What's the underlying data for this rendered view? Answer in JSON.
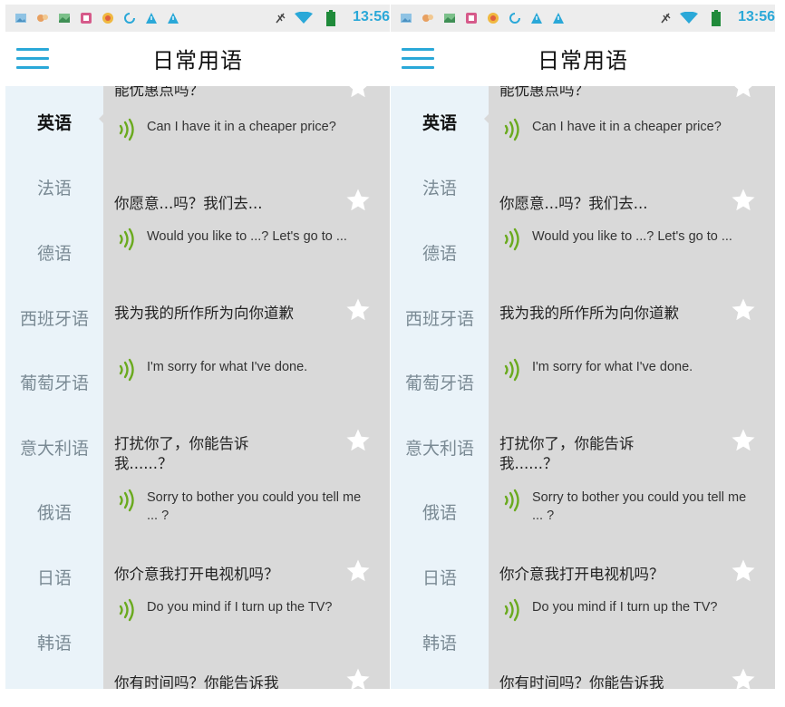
{
  "status_bar": {
    "time": "13:56",
    "colors": {
      "accent": "#2aa8d8",
      "battery": "#1f8a3a",
      "wifi": "#2aa8d8"
    }
  },
  "app_bar": {
    "title": "日常用语",
    "menu_icon": "hamburger-menu-icon"
  },
  "sidebar": {
    "items": [
      {
        "label": "英语",
        "active": true
      },
      {
        "label": "法语",
        "active": false
      },
      {
        "label": "德语",
        "active": false
      },
      {
        "label": "西班牙语",
        "active": false
      },
      {
        "label": "葡萄牙语",
        "active": false
      },
      {
        "label": "意大利语",
        "active": false
      },
      {
        "label": "俄语",
        "active": false
      },
      {
        "label": "日语",
        "active": false
      },
      {
        "label": "韩语",
        "active": false
      }
    ]
  },
  "phrases": {
    "partial_top": "能优惠点吗？",
    "items": [
      {
        "cn": "",
        "en": "Can I have it in a cheaper price?"
      },
      {
        "cn": "你愿意...吗？我们去...",
        "en": "Would you like to ...? Let's go to ..."
      },
      {
        "cn": "我为我的所作所为向你道歉",
        "en": "I'm sorry for what I've done."
      },
      {
        "cn": "打扰你了，你能告诉我......？",
        "en": "Sorry to bother you  could you tell me ... ?"
      },
      {
        "cn": "你介意我打开电视机吗？",
        "en": "Do you mind if I turn up the TV?"
      }
    ],
    "partial_bottom": "你有时间吗？你能告诉我"
  },
  "icons": {
    "speaker": "speaker-icon",
    "favorite": "star-icon"
  }
}
